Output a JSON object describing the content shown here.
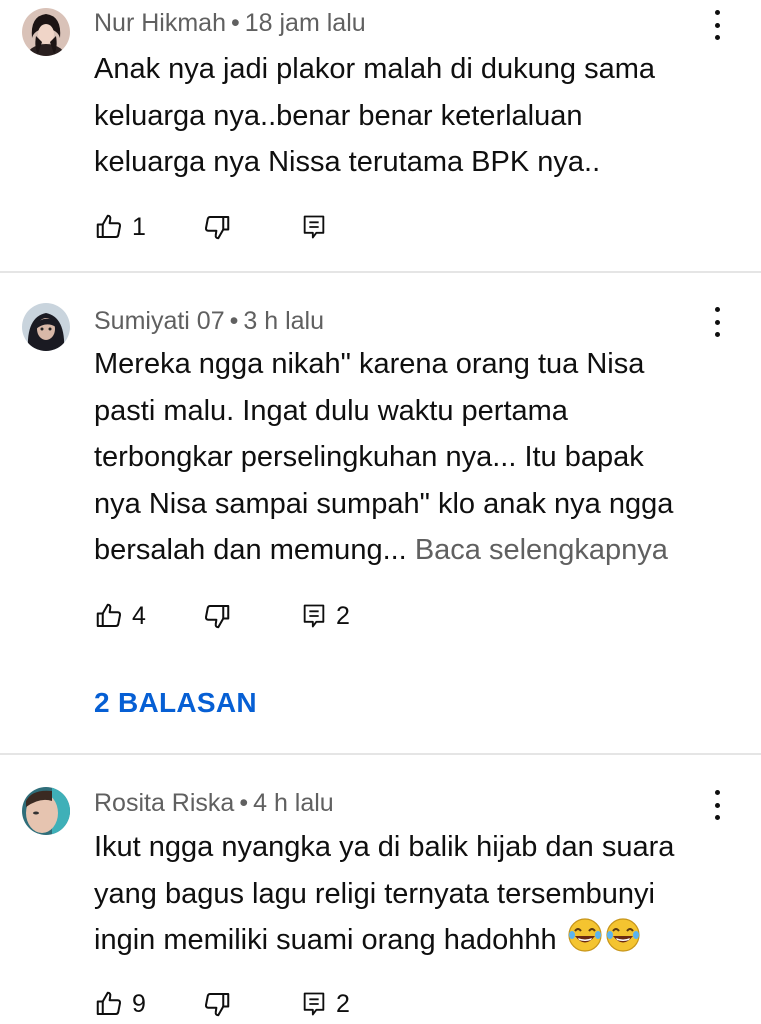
{
  "comments": [
    {
      "author": "Nur Hikmah",
      "separator": "•",
      "time": "18 jam lalu",
      "lines": [
        "Anak nya jadi plakor malah di dukung sama",
        "keluarga nya..benar benar keterlaluan",
        "keluarga nya Nissa terutama BPK nya.."
      ],
      "likes": "1",
      "reply_count": ""
    },
    {
      "author": "Sumiyati 07",
      "separator": "•",
      "time": "3 h lalu",
      "lines": [
        "Mereka ngga nikah\" karena orang tua Nisa",
        "pasti malu. Ingat dulu waktu pertama",
        "terbongkar perselingkuhan nya... Itu bapak",
        "nya Nisa sampai sumpah\" klo anak nya ngga",
        "bersalah dan memung..."
      ],
      "read_more": "Baca selengkapnya",
      "likes": "4",
      "reply_count": "2",
      "replies_link": "2 BALASAN"
    },
    {
      "author": "Rosita Riska",
      "separator": "•",
      "time": "4 h lalu",
      "lines": [
        "Ikut ngga nyangka ya di balik hijab dan suara",
        "yang bagus lagu religi ternyata tersembunyi",
        "ingin memiliki suami orang hadohhh"
      ],
      "emoji": "😂😂",
      "likes": "9",
      "reply_count": "2"
    }
  ],
  "icons": {
    "like": "thumb-up-icon",
    "dislike": "thumb-down-icon",
    "reply": "reply-icon",
    "more": "more-vert-icon"
  },
  "colors": {
    "link": "#065fd4",
    "secondary_text": "#606060",
    "divider": "#e5e5e5",
    "emoji": "#f4c430"
  }
}
